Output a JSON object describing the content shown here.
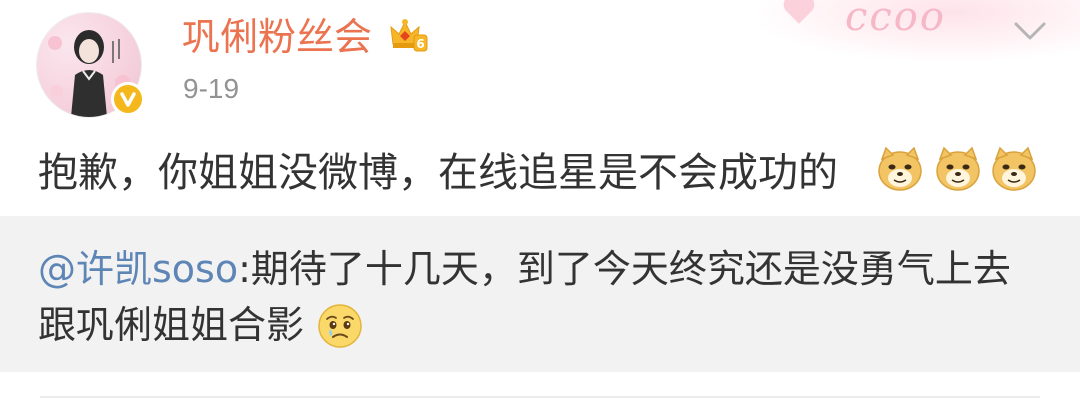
{
  "post": {
    "username": "巩俐粉丝会",
    "member_icon": "crown-vip-icon",
    "member_level": "6",
    "timestamp": "9-19",
    "text": "抱歉，你姐姐没微博，在线追星是不会成功的",
    "emojis": [
      "doge-emoji",
      "doge-emoji",
      "doge-emoji"
    ],
    "verified_badge": "v",
    "decor_text": "ccoo"
  },
  "repost": {
    "mention": "@许凯soso",
    "separator": ":",
    "line1_text": "期待了十几天，到了今天终究还是没勇气上去",
    "line2_text": "跟巩俐姐姐合影",
    "emoji": "sad-tearful-emoji"
  },
  "colors": {
    "username": "#eb7350",
    "mention": "#5d85b5",
    "timestamp": "#939393",
    "repost_bg": "#f2f2f2",
    "verified_badge": "#f5b81c"
  }
}
